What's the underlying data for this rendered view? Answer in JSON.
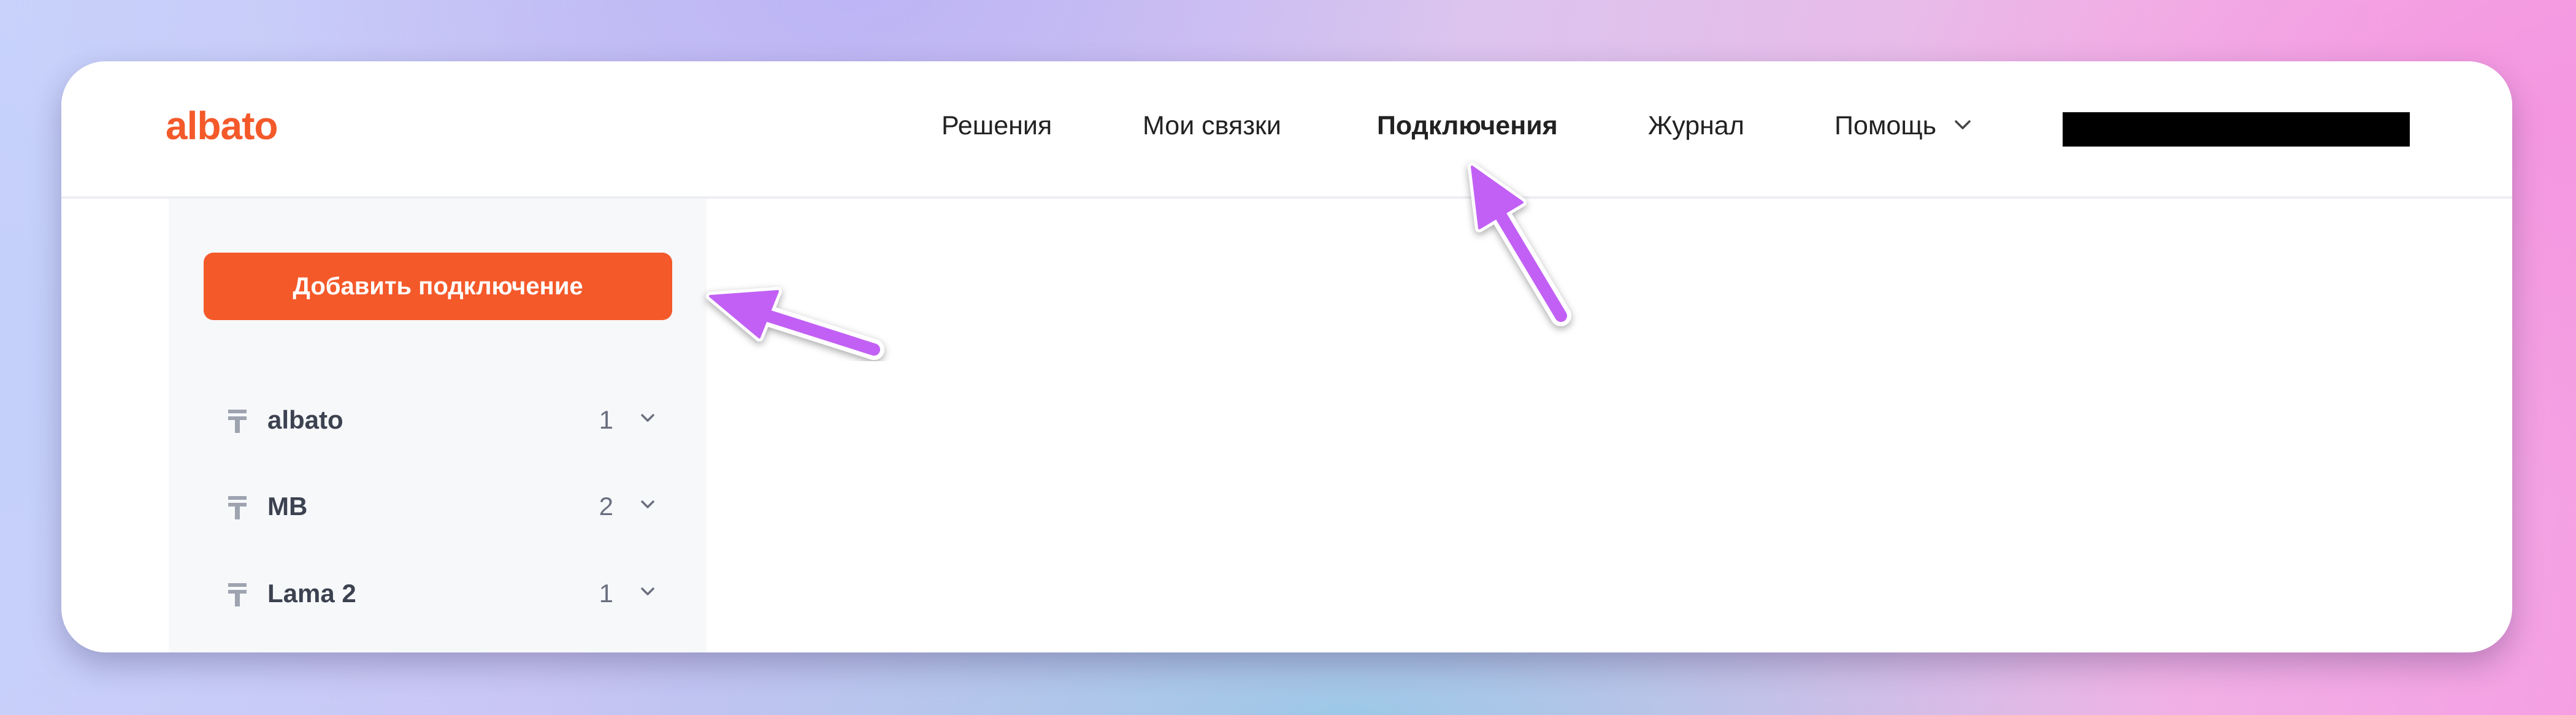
{
  "app": {
    "logo_text": "albato",
    "brand_color": "#f4592a"
  },
  "nav": {
    "items": [
      {
        "label": "Решения"
      },
      {
        "label": "Мои связки"
      },
      {
        "label": "Подключения",
        "active": true
      },
      {
        "label": "Журнал"
      },
      {
        "label": "Помощь",
        "has_dropdown": true
      }
    ],
    "user_account_redacted": true
  },
  "sidebar": {
    "add_button_label": "Добавить подключение",
    "groups": [
      {
        "name": "albato",
        "count": "1",
        "icon": "app-group-icon"
      },
      {
        "name": "MB",
        "count": "2",
        "icon": "app-group-icon"
      },
      {
        "name": "Lama 2",
        "count": "1",
        "icon": "app-group-icon"
      }
    ]
  },
  "annotations": {
    "arrow_color": "#c260f5",
    "arrows": [
      "pointing-to-add-connection-button",
      "pointing-to-connections-nav-item"
    ]
  }
}
